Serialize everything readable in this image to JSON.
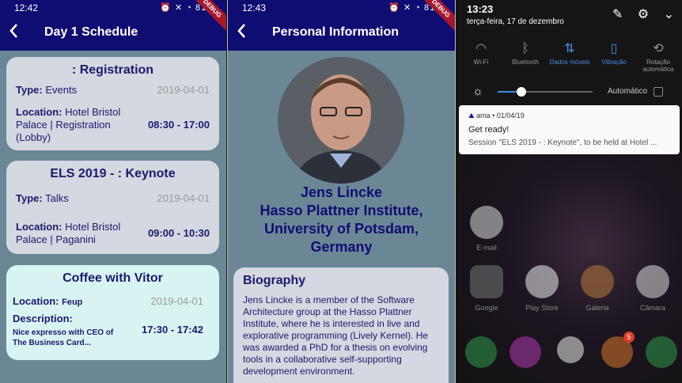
{
  "panel1": {
    "status": {
      "time": "12:42",
      "right": "⏰ ✕ ◔ 81%"
    },
    "debug_badge": "DEBUG",
    "title": "Day 1 Schedule",
    "cards": [
      {
        "title": ": Registration",
        "type_label": "Type:",
        "type_value": "Events",
        "date": "2019-04-01",
        "loc_label": "Location:",
        "loc_value": "Hotel Bristol Palace | Registration (Lobby)",
        "hours": "08:30 - 17:00"
      },
      {
        "title": "ELS 2019 - : Keynote",
        "type_label": "Type:",
        "type_value": "Talks",
        "date": "2019-04-01",
        "loc_label": "Location:",
        "loc_value": "Hotel Bristol Palace | Paganini",
        "hours": "09:00 - 10:30"
      },
      {
        "title": "Coffee with Vitor",
        "loc_label": "Location:",
        "loc_value": "Feup",
        "date": "2019-04-01",
        "desc_label": "Description:",
        "desc_value": "Nice expresso with CEO of The Business Card...",
        "hours": "17:30 - 17:42"
      }
    ]
  },
  "panel2": {
    "status": {
      "time": "12:43",
      "right": "⏰ ✕ ◔ 81%"
    },
    "debug_badge": "DEBUG",
    "title": "Personal Information",
    "name_lines": [
      "Jens Lincke",
      "Hasso Plattner Institute,",
      "University of Potsdam,",
      "Germany"
    ],
    "bio_heading": "Biography",
    "bio_text": "Jens Lincke is a member of the Software Architecture group at the Hasso Plattner Institute, where he is interested in live and explorative programming (Lively Kernel). He was awarded a PhD for a thesis on evolving tools in a collaborative self-supporting development environment."
  },
  "panel3": {
    "time": "13:23",
    "date": "terça-feira, 17 de dezembro",
    "tiles": [
      {
        "label": "Wi-Fi",
        "icon": "wifi-icon",
        "on": false
      },
      {
        "label": "Bluetooth",
        "icon": "bluetooth-icon",
        "on": false
      },
      {
        "label": "Dados móveis",
        "icon": "mobile-data-icon",
        "on": true
      },
      {
        "label": "Vibração",
        "icon": "vibration-icon",
        "on": true
      },
      {
        "label": "Rotação automática",
        "icon": "rotation-icon",
        "on": false
      }
    ],
    "brightness_label": "Automático",
    "brightness_level": 0.25,
    "notification": {
      "app": "ama",
      "date": "01/04/19",
      "title": "Get ready!",
      "body": "Session \"ELS 2019 - : Keynote\", to be held at Hotel ..."
    },
    "apps": [
      "E-mail",
      "Google",
      "Play Store",
      "Galeria",
      "Câmara"
    ],
    "badge_count": "5"
  }
}
